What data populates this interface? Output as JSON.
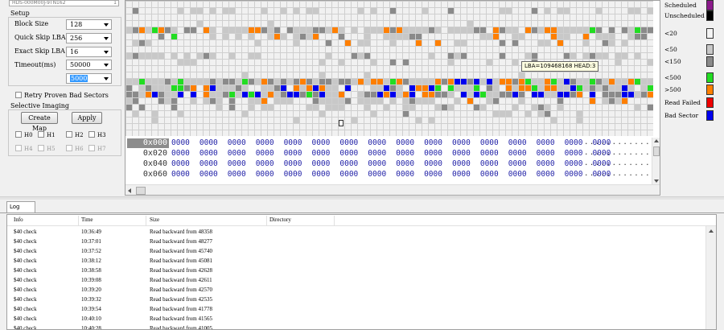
{
  "setup": {
    "model_text": "HDS-000M00J-9TN162",
    "model_suffix": "1",
    "group_title": "Setup",
    "block_size_label": "Block Size",
    "block_size_value": "128",
    "quick_skip_label": "Quick Skip LBA",
    "quick_skip_value": "256",
    "exact_skip_label": "Exact Skip LBA",
    "exact_skip_value": "16",
    "timeout_label": "Timeout(ms)",
    "timeout_value": "50000",
    "timeout2_value": "5000",
    "retry_label": "Retry Proven Bad Sectors"
  },
  "selective": {
    "title": "Selective Imaging",
    "create_map_label": "Create Map",
    "apply_label": "Apply",
    "heads": [
      "H0",
      "H1",
      "H2",
      "H3",
      "H4",
      "H5",
      "H6",
      "H7"
    ]
  },
  "map": {
    "tooltip": "LBA=109468168   HEAD:3"
  },
  "hex": {
    "rows": [
      {
        "addr": "0x000",
        "words": "0000 0000 0000 0000 0000 0000 0000 0000 0000 0000 0000 0000 0000 0000 0000 0000",
        "dots": "................"
      },
      {
        "addr": "0x020",
        "words": "0000 0000 0000 0000 0000 0000 0000 0000 0000 0000 0000 0000 0000 0000 0000 0000",
        "dots": "................"
      },
      {
        "addr": "0x040",
        "words": "0000 0000 0000 0000 0000 0000 0000 0000 0000 0000 0000 0000 0000 0000 0000 0000",
        "dots": "................"
      },
      {
        "addr": "0x060",
        "words": "0000 0000 0000 0000 0000 0000 0000 0000 0000 0000 0000 0000 0000 0000 0000 0000",
        "dots": "................"
      }
    ]
  },
  "legend": [
    {
      "label": "Scheduled",
      "color": "#8b1a8b"
    },
    {
      "label": "Unscheduled",
      "color": "#000000"
    },
    {
      "label": "<20",
      "color": "#f4f4f4"
    },
    {
      "label": "<50",
      "color": "#c8c8c8"
    },
    {
      "label": "<150",
      "color": "#8a8a8a"
    },
    {
      "label": "<500",
      "color": "#22dd22"
    },
    {
      "label": ">500",
      "color": "#ff7f00"
    },
    {
      "label": "Read Failed",
      "color": "#ee0000"
    },
    {
      "label": "Bad Sector",
      "color": "#0000ee"
    }
  ],
  "log": {
    "tab_label": "Log",
    "columns": [
      "Info",
      "Time",
      "Size",
      "Directory"
    ],
    "rows": [
      {
        "info": "$40 check",
        "time": "10:36:49",
        "size": "Read backward from 48358"
      },
      {
        "info": "$40 check",
        "time": "10:37:01",
        "size": "Read backward from 48277"
      },
      {
        "info": "$40 check",
        "time": "10:37:52",
        "size": "Read backward from 45740"
      },
      {
        "info": "$40 check",
        "time": "10:38:12",
        "size": "Read backward from 45081"
      },
      {
        "info": "$40 check",
        "time": "10:38:58",
        "size": "Read backward from 42628"
      },
      {
        "info": "$40 check",
        "time": "10:39:08",
        "size": "Read backward from 42611"
      },
      {
        "info": "$40 check",
        "time": "10:39:20",
        "size": "Read backward from 42570"
      },
      {
        "info": "$40 check",
        "time": "10:39:32",
        "size": "Read backward from 42535"
      },
      {
        "info": "$40 check",
        "time": "10:39:54",
        "size": "Read backward from 41778"
      },
      {
        "info": "$40 check",
        "time": "10:40:10",
        "size": "Read backward from 41565"
      },
      {
        "info": "$40 check",
        "time": "10:40:28",
        "size": "Read backward from 41005"
      }
    ]
  }
}
